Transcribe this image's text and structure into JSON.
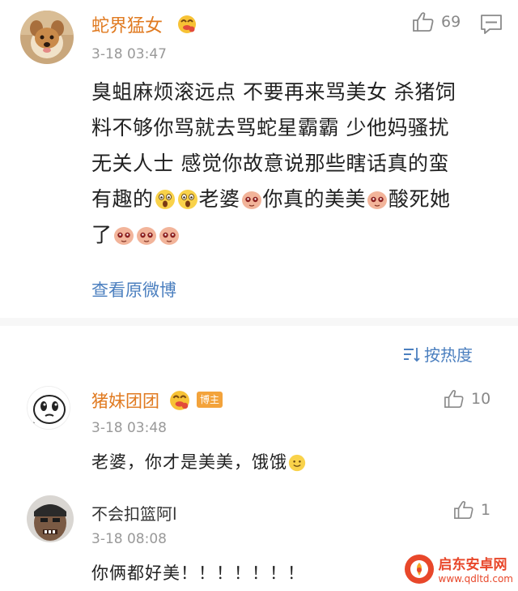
{
  "main_comment": {
    "username": "蛇界猛女",
    "username_color": "#e07a20",
    "timestamp": "3-18 03:47",
    "like_count": "69",
    "body_line1": "臭蛆麻烦滚远点 不要再来骂美女 杀猪饲",
    "body_line2": "料不够你骂就去骂蛇星霸霸 少他妈骚扰",
    "body_line3": "无关人士 感觉你故意说那些瞎话真的蛮",
    "body_line4_a": "有趣的",
    "body_line4_b": "老婆",
    "body_line4_c": "你真的美美",
    "body_line4_d": "酸死她",
    "body_line5": "了",
    "view_original": "查看原微博"
  },
  "sort": {
    "label": "按热度"
  },
  "replies": [
    {
      "username": "猪妹团团",
      "username_color": "#e07a20",
      "badge": "博主",
      "timestamp": "3-18 03:48",
      "like_count": "10",
      "text": "老婆，你才是美美，饿饿"
    },
    {
      "username": "不会扣篮阿l",
      "username_color": "#333333",
      "timestamp": "3-18 08:08",
      "like_count": "1",
      "text": "你俩都好美！！！！！！！"
    }
  ],
  "watermark": {
    "title": "启东安卓网",
    "url": "www.qdltd.com"
  },
  "colors": {
    "link": "#4b7fbf",
    "gold_user": "#e07a20",
    "badge_bg": "#f3a33b"
  },
  "icons": [
    "thumbs-up-icon",
    "comment-icon",
    "sort-icon",
    "surprised-emoji",
    "shy-emoji",
    "blush-emoji"
  ]
}
